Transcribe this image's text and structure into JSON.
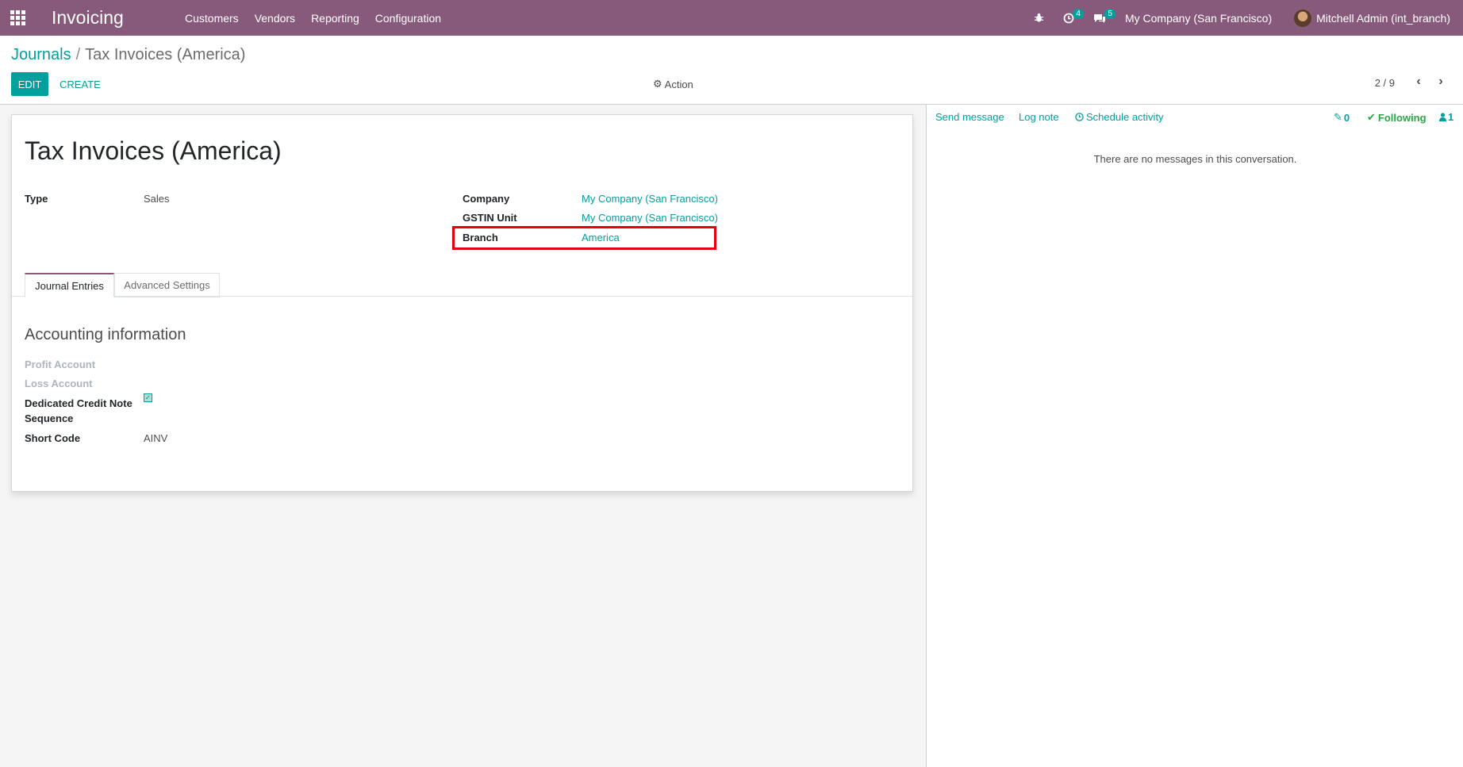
{
  "navbar": {
    "app_name": "Invoicing",
    "menu": [
      "Customers",
      "Vendors",
      "Reporting",
      "Configuration"
    ],
    "activity_count": "4",
    "message_count": "5",
    "company": "My Company (San Francisco)",
    "user": "Mitchell Admin (int_branch)"
  },
  "breadcrumb": {
    "parent": "Journals",
    "separator": "/",
    "current": "Tax Invoices (America)"
  },
  "toolbar": {
    "edit_label": "EDIT",
    "create_label": "CREATE",
    "action_label": "Action",
    "pager": "2 / 9"
  },
  "form": {
    "title": "Tax Invoices (America)",
    "type_label": "Type",
    "type_value": "Sales",
    "company_label": "Company",
    "company_value": "My Company (San Francisco)",
    "gstin_label": "GSTIN Unit",
    "gstin_value": "My Company (San Francisco)",
    "branch_label": "Branch",
    "branch_value": "America",
    "tabs": [
      "Journal Entries",
      "Advanced Settings"
    ],
    "section_title": "Accounting information",
    "profit_account_label": "Profit Account",
    "loss_account_label": "Loss Account",
    "credit_note_label_line1": "Dedicated Credit Note",
    "credit_note_label_line2": "Sequence",
    "credit_note_checked": true,
    "short_code_label": "Short Code",
    "short_code_value": "AINV"
  },
  "chatter": {
    "send_message": "Send message",
    "log_note": "Log note",
    "schedule_activity": "Schedule activity",
    "attachments": "0",
    "following": "Following",
    "followers": "1",
    "empty_text": "There are no messages in this conversation."
  },
  "colors": {
    "brand": "#875a7b",
    "accent": "#00a09d",
    "highlight": "#e3000f"
  }
}
